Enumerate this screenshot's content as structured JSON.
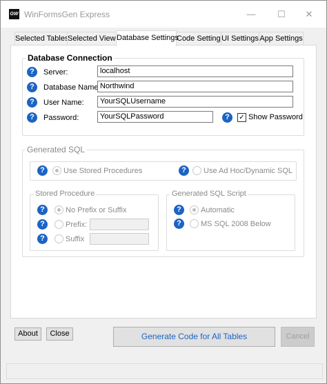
{
  "window": {
    "title": "WinFormsGen Express",
    "app_icon_text": "GW",
    "minimize": "—",
    "maximize": "☐",
    "close": "✕"
  },
  "tabs": [
    {
      "label": "Selected Tables",
      "active": false
    },
    {
      "label": "Selected Views",
      "active": false
    },
    {
      "label": "Database Settings",
      "active": true
    },
    {
      "label": "Code Settings",
      "active": false
    },
    {
      "label": "UI Settings",
      "active": false
    },
    {
      "label": "App Settings",
      "active": false
    }
  ],
  "db": {
    "legend": "Database Connection",
    "server_label": "Server:",
    "server_value": "localhost",
    "dbname_label": "Database Name:",
    "dbname_value": "Northwind",
    "user_label": "User Name:",
    "user_value": "YourSQLUsername",
    "password_label": "Password:",
    "password_value": "YourSQLPassword",
    "show_password_label": "Show Password",
    "show_password_checked": true
  },
  "gensql": {
    "legend": "Generated SQL",
    "stored_label": "Use Stored Procedures",
    "adhoc_label": "Use Ad Hoc/Dynamic SQL",
    "stored_selected": true
  },
  "stored_proc": {
    "legend": "Stored Procedure",
    "noprefix_label": "No Prefix or Suffix",
    "prefix_label": "Prefix:",
    "suffix_label": "Suffix",
    "prefix_value": "",
    "suffix_value": ""
  },
  "script": {
    "legend": "Generated SQL Script",
    "auto_label": "Automatic",
    "ms_label": "MS SQL 2008  Below",
    "auto_selected": true
  },
  "footer": {
    "about": "About",
    "close": "Close",
    "generate": "Generate Code for All Tables",
    "cancel": "Cancel"
  },
  "help_glyph": "?",
  "colors": {
    "help": "#1b64c4",
    "generate_text": "#1b64c4"
  }
}
